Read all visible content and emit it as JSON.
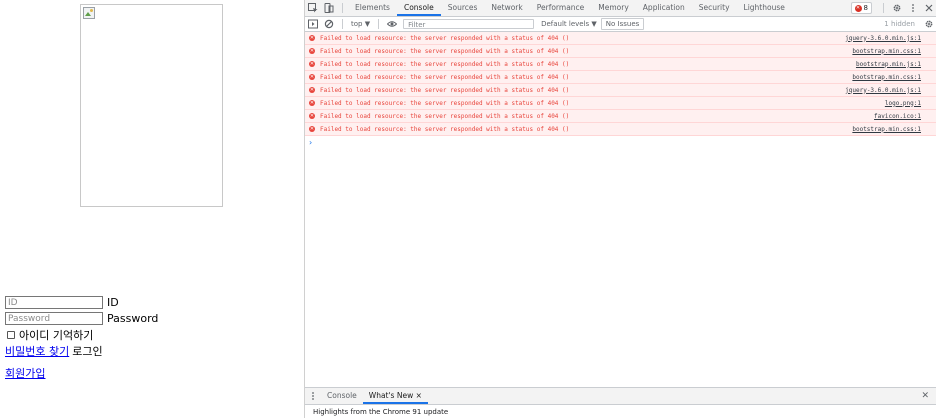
{
  "page": {
    "id_placeholder": "ID",
    "id_label": "ID",
    "pw_placeholder": "Password",
    "pw_label": "Password",
    "remember_label": "아이디 기억하기",
    "find_pw_link": "비밀번호 찾기",
    "login_label": "로그인",
    "signup_link": "회원가입"
  },
  "devtools": {
    "tabs": [
      "Elements",
      "Console",
      "Sources",
      "Network",
      "Performance",
      "Memory",
      "Application",
      "Security",
      "Lighthouse"
    ],
    "active_tab": "Console",
    "error_count": "8",
    "toolbar": {
      "context": "top ▼",
      "filter_placeholder": "Filter",
      "levels": "Default levels ▼",
      "issues": "No Issues",
      "hidden": "1 hidden"
    },
    "messages": [
      {
        "text": "Failed to load resource: the server responded with a status of 404 ()",
        "source": "jquery-3.6.0.min.js:1"
      },
      {
        "text": "Failed to load resource: the server responded with a status of 404 ()",
        "source": "bootstrap.min.css:1"
      },
      {
        "text": "Failed to load resource: the server responded with a status of 404 ()",
        "source": "bootstrap.min.js:1"
      },
      {
        "text": "Failed to load resource: the server responded with a status of 404 ()",
        "source": "bootstrap.min.css:1"
      },
      {
        "text": "Failed to load resource: the server responded with a status of 404 ()",
        "source": "jquery-3.6.0.min.js:1"
      },
      {
        "text": "Failed to load resource: the server responded with a status of 404 ()",
        "source": "logo.png:1"
      },
      {
        "text": "Failed to load resource: the server responded with a status of 404 ()",
        "source": "favicon.ico:1"
      },
      {
        "text": "Failed to load resource: the server responded with a status of 404 ()",
        "source": "bootstrap.min.css:1"
      }
    ],
    "prompt": "›",
    "drawer": {
      "tab_console": "Console",
      "tab_whatsnew": "What's New",
      "tab_close": "×",
      "body": "Highlights from the Chrome 91 update"
    },
    "colors": {
      "accent": "#1a73e8",
      "error": "#e8453c",
      "error_bg": "#fff0f0"
    }
  }
}
